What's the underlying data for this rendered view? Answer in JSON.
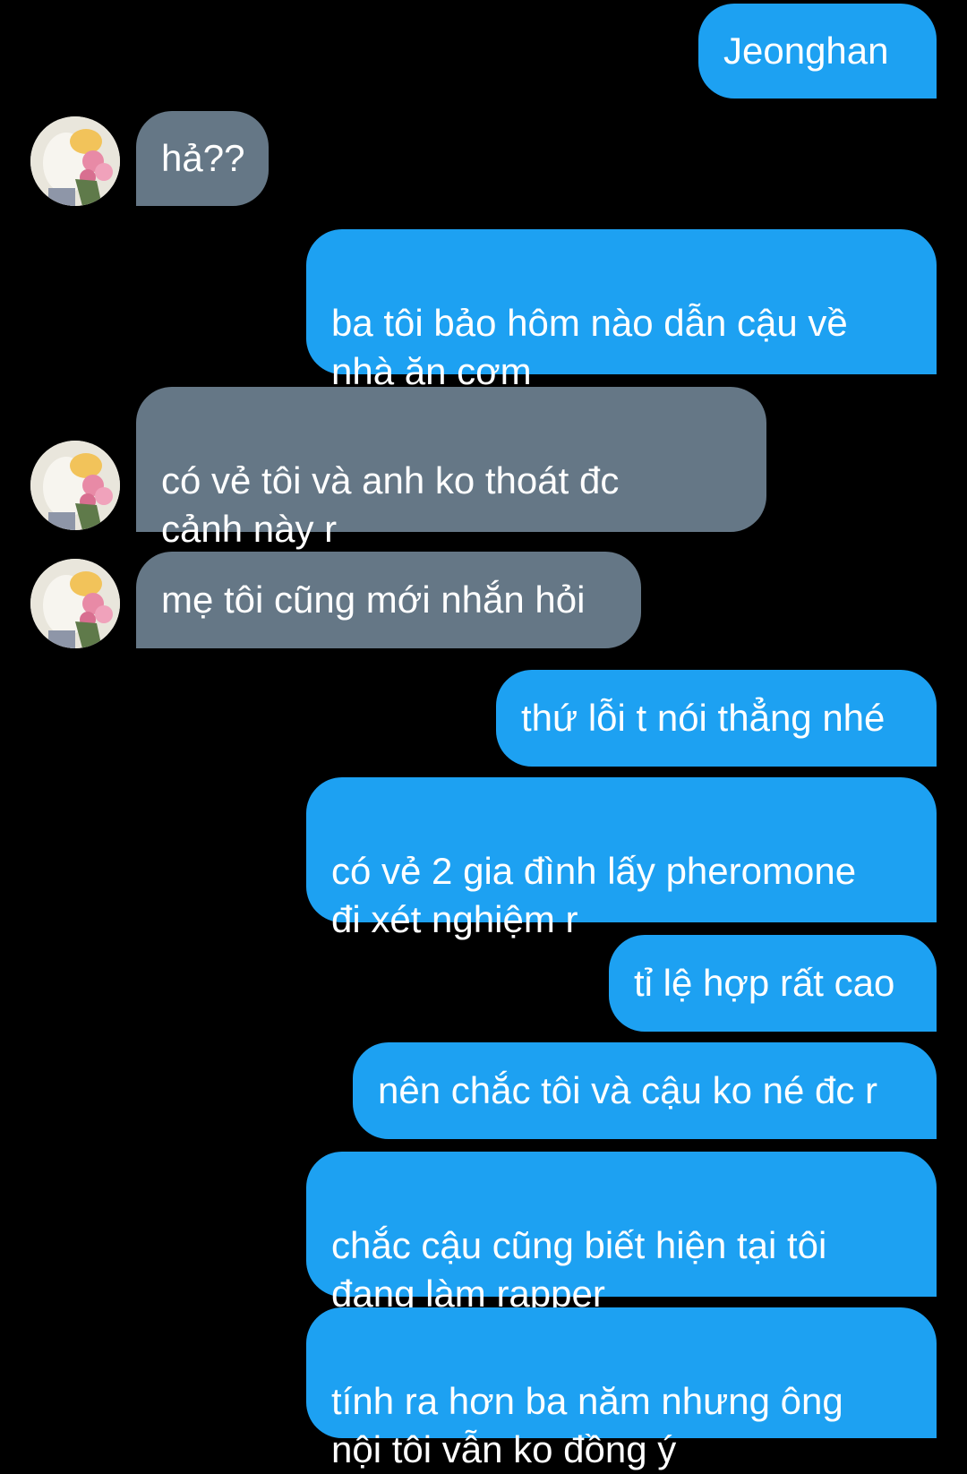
{
  "conversation": {
    "messages": [
      {
        "sender": "me",
        "text": "Jeonghan"
      },
      {
        "sender": "them",
        "text": "hả??"
      },
      {
        "sender": "me",
        "text": "ba tôi bảo hôm nào dẫn cậu về\nnhà ăn cơm"
      },
      {
        "sender": "them",
        "text": "có vẻ tôi và anh ko thoát đc\ncảnh này r"
      },
      {
        "sender": "them",
        "text": "mẹ tôi cũng mới nhắn hỏi"
      },
      {
        "sender": "me",
        "text": "thứ lỗi t nói thẳng nhé"
      },
      {
        "sender": "me",
        "text": "có vẻ 2 gia đình lấy pheromone\nđi xét nghiệm r"
      },
      {
        "sender": "me",
        "text": "tỉ lệ hợp rất cao"
      },
      {
        "sender": "me",
        "text": "nên chắc tôi và cậu ko né đc r"
      },
      {
        "sender": "me",
        "text": "chắc cậu cũng biết hiện tại tôi\nđang làm rapper"
      },
      {
        "sender": "me",
        "text": "tính ra hơn ba năm nhưng ông\nnội tôi vẫn ko đồng ý"
      }
    ]
  },
  "colors": {
    "background": "#000000",
    "sent_bubble": "#1da1f2",
    "received_bubble": "#657786",
    "text": "#ffffff"
  },
  "icons": {
    "avatar": "profile-photo-avatar-icon"
  }
}
